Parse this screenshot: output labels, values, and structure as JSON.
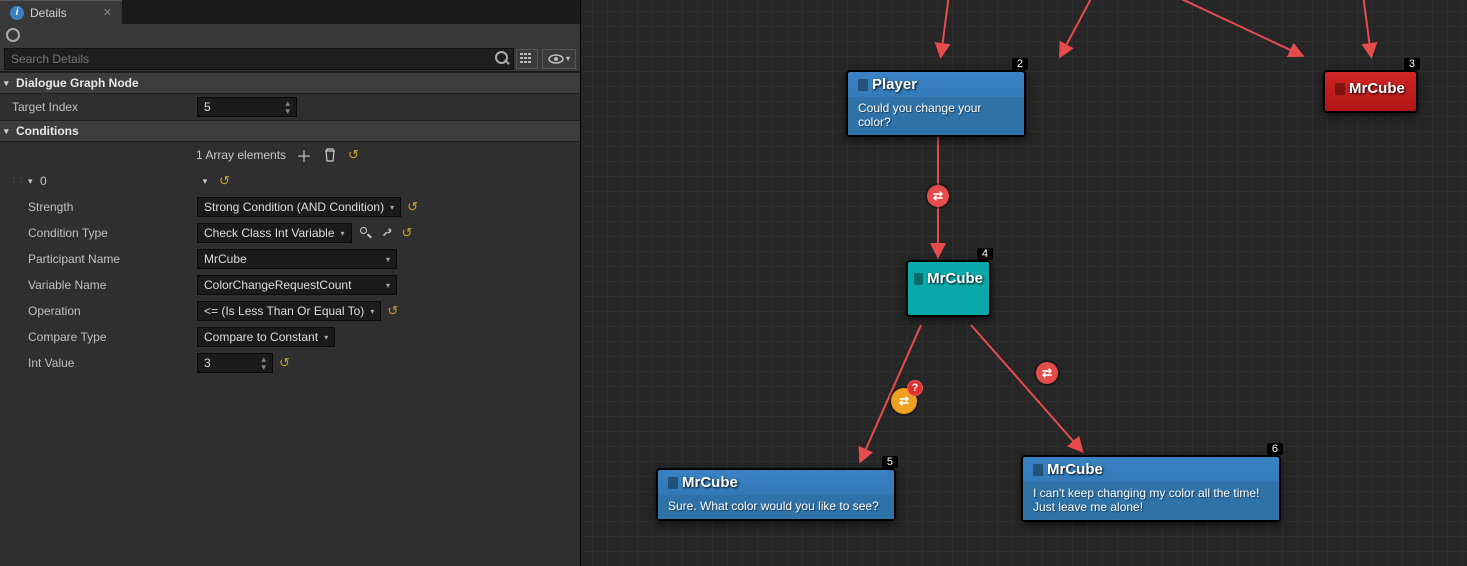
{
  "tab": {
    "title": "Details"
  },
  "search": {
    "placeholder": "Search Details"
  },
  "sections": {
    "graphNode": {
      "title": "Dialogue Graph Node"
    },
    "conditions": {
      "title": "Conditions"
    }
  },
  "props": {
    "targetIndex": {
      "label": "Target Index",
      "value": "5"
    },
    "arrayHeader": {
      "text": "1 Array elements"
    },
    "elem0": {
      "label": "0"
    },
    "strength": {
      "label": "Strength",
      "value": "Strong Condition (AND Condition)"
    },
    "conditionType": {
      "label": "Condition Type",
      "value": "Check Class Int Variable"
    },
    "participantName": {
      "label": "Participant Name",
      "value": "MrCube"
    },
    "variableName": {
      "label": "Variable Name",
      "value": "ColorChangeRequestCount"
    },
    "operation": {
      "label": "Operation",
      "value": "<= (Is Less Than Or Equal To)"
    },
    "compareType": {
      "label": "Compare Type",
      "value": "Compare to Constant"
    },
    "intValue": {
      "label": "Int Value",
      "value": "3"
    }
  },
  "graph": {
    "nodes": {
      "n2": {
        "title": "Player",
        "text": "Could you change your color?",
        "tag": "2"
      },
      "n3": {
        "title": "MrCube",
        "tag": "3"
      },
      "n4": {
        "title": "MrCube",
        "tag": "4"
      },
      "n5": {
        "title": "MrCube",
        "text": "Sure. What color would you like to see?",
        "tag": "5"
      },
      "n6": {
        "title": "MrCube",
        "text": "I can't keep changing my color all the time! Just leave me alone!",
        "tag": "6"
      }
    }
  }
}
